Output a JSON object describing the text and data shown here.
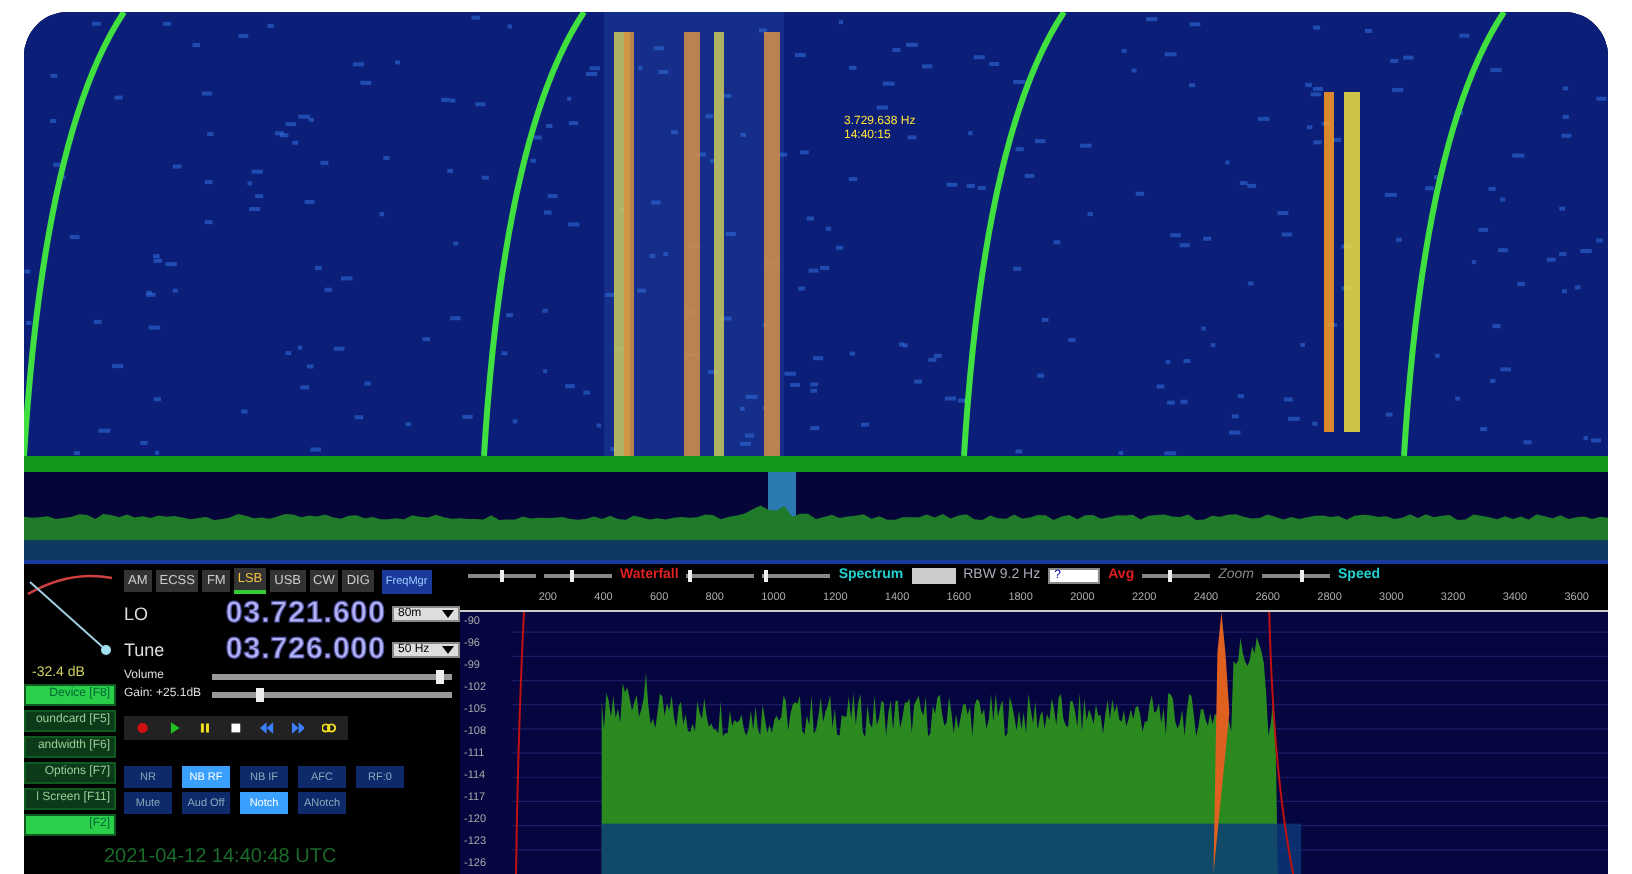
{
  "waterfall": {
    "marker_frequency": "3.729.638 Hz",
    "marker_time": "14:40:15"
  },
  "s_meter": {
    "reading": "-32.4 dB"
  },
  "modes": [
    {
      "label": "AM",
      "selected": false
    },
    {
      "label": "ECSS",
      "selected": false
    },
    {
      "label": "FM",
      "selected": false
    },
    {
      "label": "LSB",
      "selected": true
    },
    {
      "label": "USB",
      "selected": false
    },
    {
      "label": "CW",
      "selected": false
    },
    {
      "label": "DIG",
      "selected": false
    }
  ],
  "freq_manager": "FreqMgr",
  "lo": {
    "label": "LO",
    "value": "03.721.600",
    "band": "80m"
  },
  "tune": {
    "label": "Tune",
    "value": "03.726.000",
    "step": "50 Hz"
  },
  "volume": {
    "label": "Volume",
    "level": 0.95
  },
  "gain": {
    "label": "Gain: +25.1dB",
    "level": 0.2
  },
  "transport": [
    {
      "kind": "record"
    },
    {
      "kind": "play"
    },
    {
      "kind": "pause"
    },
    {
      "kind": "stop"
    },
    {
      "kind": "rewind"
    },
    {
      "kind": "forward"
    },
    {
      "kind": "loop"
    }
  ],
  "side_buttons": [
    {
      "label": "Device [F8]",
      "on": true
    },
    {
      "label": "oundcard [F5]",
      "on": false
    },
    {
      "label": "andwidth [F6]",
      "on": false
    },
    {
      "label": "Options [F7]",
      "on": false
    },
    {
      "label": "l Screen [F11]",
      "on": false
    },
    {
      "label": "[F2]",
      "on": true
    }
  ],
  "dsp_buttons": [
    {
      "label": "NR",
      "on": false
    },
    {
      "label": "NB RF",
      "on": true
    },
    {
      "label": "NB IF",
      "on": false
    },
    {
      "label": "AFC",
      "on": false
    },
    {
      "label": "RF:0",
      "on": false
    },
    {
      "label": "Mute",
      "on": false
    },
    {
      "label": "Aud Off",
      "on": false
    },
    {
      "label": "Notch",
      "on": true
    },
    {
      "label": "ANotch",
      "on": false
    }
  ],
  "clock": "2021-04-12  14:40:48 UTC",
  "spectrum_controls": {
    "waterfall_sliders": [
      {
        "level": 0.5
      },
      {
        "level": 0.4
      }
    ],
    "spectrum_sliders": [
      {
        "level": 0.05
      },
      {
        "level": 0.05
      }
    ],
    "zoom_slider": {
      "level": 0.4
    },
    "speed_slider": {
      "level": 0.6
    },
    "waterfall_label": "Waterfall",
    "spectrum_label": "Spectrum",
    "rbw": "RBW  9.2 Hz",
    "avg_select": "?",
    "avg_label": "Avg",
    "zoom_label": "Zoom",
    "speed_label": "Speed"
  },
  "spectrum": {
    "x_labels": [
      "200",
      "400",
      "600",
      "800",
      "1000",
      "1200",
      "1400",
      "1600",
      "1800",
      "2000",
      "2200",
      "2400",
      "2600",
      "2800",
      "3000",
      "3200",
      "3400",
      "3600"
    ],
    "y_labels": [
      "-90",
      "-96",
      "-99",
      "-102",
      "-105",
      "-108",
      "-111",
      "-114",
      "-117",
      "-120",
      "-123",
      "-126"
    ]
  }
}
